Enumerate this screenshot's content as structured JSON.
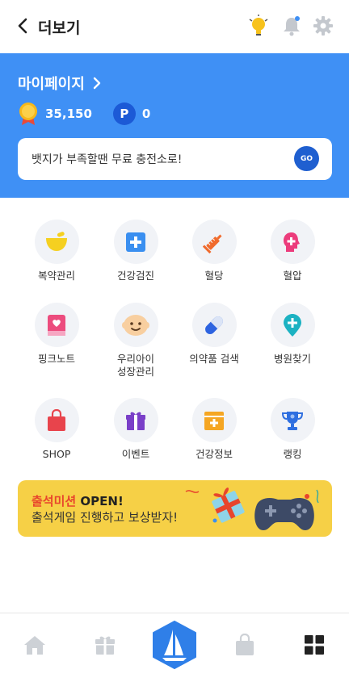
{
  "header": {
    "title": "더보기",
    "icons": [
      "back-arrow-icon",
      "lightbulb-icon",
      "bell-icon",
      "gear-icon"
    ]
  },
  "profile": {
    "mypage_label": "마이페이지",
    "points": "35,150",
    "p_badge": "P",
    "p_points": "0",
    "badge_text": "뱃지가 부족할땐 무료 충전소로!",
    "go_label": "GO"
  },
  "menu": {
    "row1": [
      "복약관리",
      "건강검진",
      "혈당",
      "혈압"
    ],
    "row2": [
      "핑크노트",
      "우리아이\n성장관리",
      "의약품 검색",
      "병원찾기"
    ],
    "row3": [
      "SHOP",
      "이벤트",
      "건강정보",
      "랭킹"
    ]
  },
  "banner": {
    "highlight": "출석미션",
    "open": " OPEN!",
    "line2": "출석게임 진행하고 보상받자!"
  },
  "nav": {
    "items": [
      "home-icon",
      "gift-icon",
      "sailboat-icon",
      "shopping-bag-icon",
      "grid-icon"
    ]
  },
  "colors": {
    "primary": "#3f90f5",
    "banner": "#f6d046",
    "accent_red": "#e8452c"
  }
}
